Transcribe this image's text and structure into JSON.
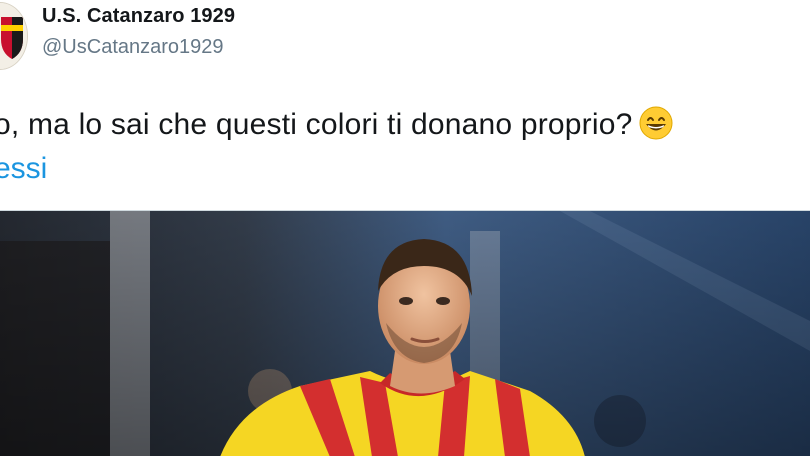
{
  "tweet": {
    "author_name": "U.S. Catanzaro 1929",
    "author_handle": "@UsCatanzaro1929",
    "text": "o, ma lo sai che questi colori ti donano proprio?",
    "mention": "essi"
  },
  "icons": {
    "avatar": "club-crest-icon",
    "emoji": "grinning-face-emoji"
  },
  "colors": {
    "handle": "#657786",
    "mention": "#1b95e0",
    "text": "#14171a"
  }
}
